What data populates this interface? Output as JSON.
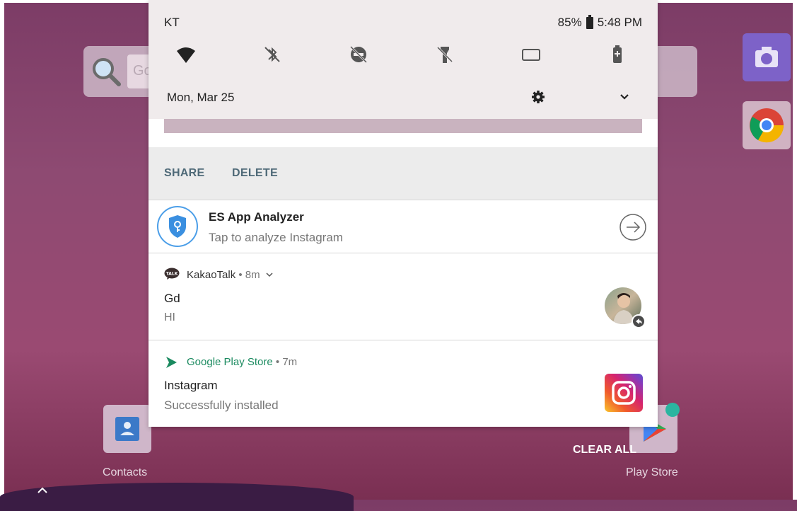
{
  "status_bar": {
    "carrier": "KT",
    "battery": "85%",
    "time": "5:48 PM"
  },
  "quick_settings": {
    "date": "Mon, Mar 25",
    "tiles": [
      "wifi-icon",
      "bluetooth-off-icon",
      "do-not-disturb-off-icon",
      "flashlight-off-icon",
      "screen-rotate-icon",
      "battery-saver-icon"
    ]
  },
  "actions": {
    "share": "SHARE",
    "delete": "DELETE"
  },
  "notifications": {
    "es": {
      "title": "ES App Analyzer",
      "text": "Tap to analyze Instagram"
    },
    "kakao": {
      "app": "KakaoTalk",
      "time": "• 8m",
      "title": "Gd",
      "text": "HI"
    },
    "play": {
      "app": "Google Play Store",
      "time": "• 7m",
      "title": "Instagram",
      "text": "Successfully installed"
    }
  },
  "launcher": {
    "search_ghost": "Google",
    "contacts_label": "Contacts",
    "playstore_label": "Play Store",
    "clear_all": "CLEAR ALL"
  },
  "colors": {
    "action_text": "#4f6a78",
    "play_green": "#1a8a5f",
    "es_blue": "#4b9ee8"
  }
}
